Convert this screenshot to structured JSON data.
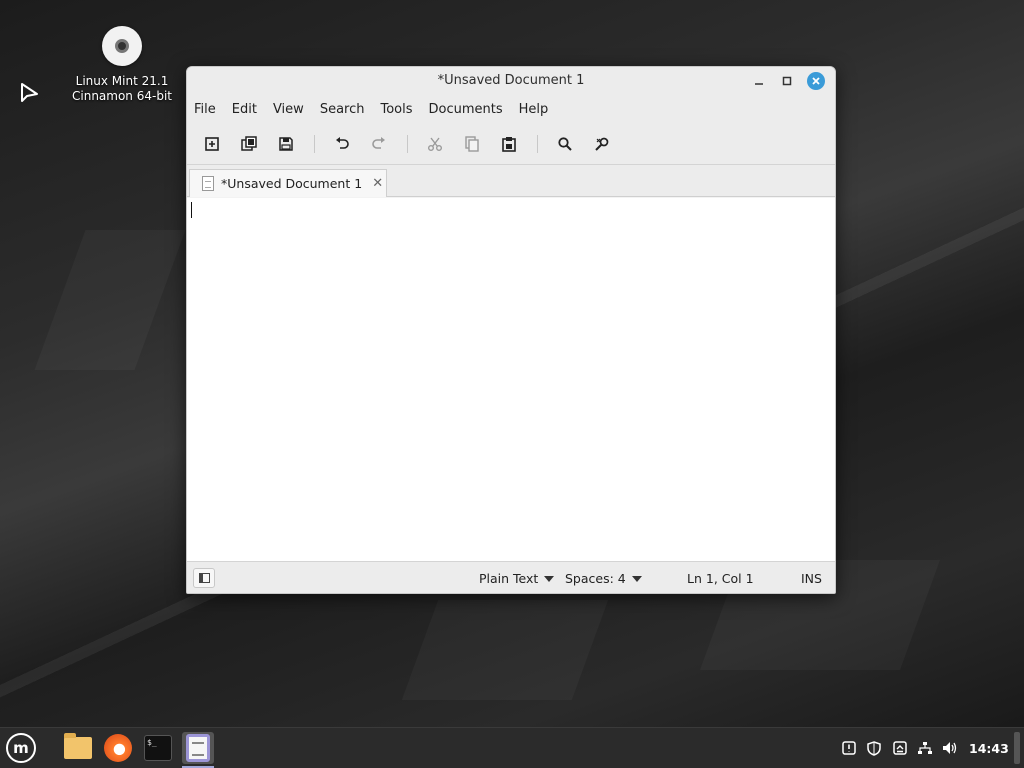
{
  "desktop": {
    "icon": {
      "name": "cd-icon",
      "label_line1": "Linux Mint 21.1",
      "label_line2": "Cinnamon 64-bit"
    }
  },
  "window": {
    "title": "*Unsaved Document 1",
    "controls": [
      "minimize",
      "maximize",
      "close"
    ],
    "close_color": "#3a9bd8"
  },
  "menubar": {
    "items": [
      "File",
      "Edit",
      "View",
      "Search",
      "Tools",
      "Documents",
      "Help"
    ]
  },
  "toolbar": {
    "buttons": [
      {
        "name": "new-document-icon",
        "enabled": true
      },
      {
        "name": "open-document-icon",
        "enabled": true
      },
      {
        "name": "save-icon",
        "enabled": true
      },
      {
        "name": "undo-icon",
        "enabled": true
      },
      {
        "name": "redo-icon",
        "enabled": false
      },
      {
        "name": "cut-icon",
        "enabled": false
      },
      {
        "name": "copy-icon",
        "enabled": false
      },
      {
        "name": "paste-icon",
        "enabled": true
      },
      {
        "name": "search-icon",
        "enabled": true
      },
      {
        "name": "replace-icon",
        "enabled": true
      }
    ]
  },
  "tabs": [
    {
      "label": "*Unsaved Document 1",
      "active": true
    }
  ],
  "editor": {
    "content": ""
  },
  "statusbar": {
    "language": "Plain Text",
    "indentation": "Spaces: 4",
    "position": "Ln 1, Col 1",
    "mode": "INS"
  },
  "taskbar": {
    "apps": [
      {
        "name": "menu-icon",
        "active": false
      },
      {
        "name": "file-manager-icon",
        "active": false
      },
      {
        "name": "firefox-icon",
        "active": false
      },
      {
        "name": "terminal-icon",
        "active": false
      },
      {
        "name": "text-editor-icon",
        "active": true
      }
    ],
    "terminal_glyph": "$_",
    "mint_glyph": "m",
    "tray": [
      "notification-icon",
      "shield-icon",
      "update-icon",
      "network-icon",
      "volume-icon"
    ],
    "clock": "14:43"
  }
}
